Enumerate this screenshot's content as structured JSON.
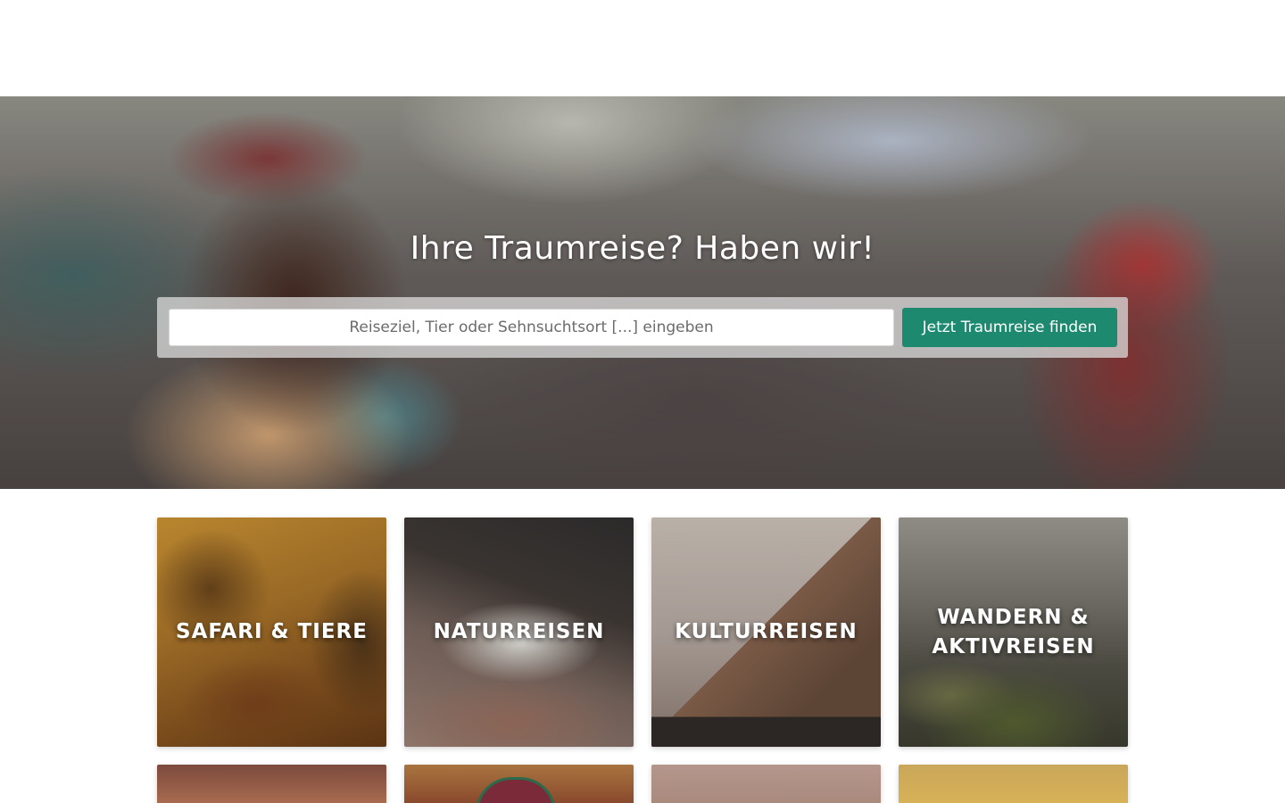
{
  "hero": {
    "title": "Ihre Traumreise? Haben wir!",
    "search": {
      "placeholder": "Reiseziel, Tier oder Sehnsuchtsort [...] eingeben",
      "value": "",
      "button_label": "Jetzt Traumreise finden"
    }
  },
  "categories": [
    {
      "label": "SAFARI & TIERE"
    },
    {
      "label": "NATURREISEN"
    },
    {
      "label": "KULTURREISEN"
    },
    {
      "label": "WANDERN & AKTIVREISEN"
    }
  ],
  "colors": {
    "accent": "#1d8a70",
    "search_panel": "#dcdcdc",
    "text_on_image": "#ffffff"
  }
}
